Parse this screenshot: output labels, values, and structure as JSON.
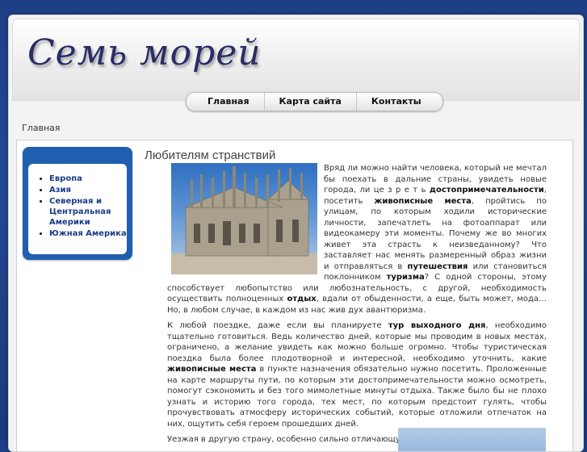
{
  "site": {
    "title": "Семь морей"
  },
  "nav": [
    "Главная",
    "Карта сайта",
    "Контакты"
  ],
  "breadcrumb": "Главная",
  "sidebar": {
    "items": [
      "Европа",
      "Азия",
      "Северная и Центральная Америки",
      "Южная Америка"
    ]
  },
  "article": {
    "title": "Любителям странствий",
    "p1_a": "Вряд ли можно найти человека, который не     мечтал бы поехать в дальние страны, увидеть новые города, ли це з р е т ь ",
    "p1_b": "достопримечательности",
    "p1_c": ", посетить ",
    "p1_d": "живописные места",
    "p1_e": ", пройтись по улицам, по которым ходили исторические     личности, запечатлеть на фотоаппарат или видеокамеру эти моменты. Почему же во многих живет эта страсть к     неизведанному? Что заставляет нас     менять размеренный образ жизни и      отправляться в      ",
    "p1_f": "путешествия",
    "p1_g": " или становиться поклонником      ",
    "p1_h": "туризма",
    "p1_i": "? С одной стороны, этому способствует       любопытство или любознательность, с другой, необходимость осуществить  полноценных ",
    "p1_j": "отдых",
    "p1_k": ", вдали от обыденности, а еще, быть может, мода… Но, в     любом случае, в каждом из   нас жив дух авантюризма.",
    "p2_a": "К любой поездке, даже если вы планируете   ",
    "p2_b": "тур выходного дня",
    "p2_c": ", необходимо тщательно готовиться. Ведь количество  дней, которые мы  проводим в новых местах, ограничено, а желание увидеть как можно больше огромно. Чтобы туристическая поездка была более плодотворной и  интересной, необходимо уточнить, какие   ",
    "p2_d": "живописные места",
    "p2_e": " в пункте назначения обязательно нужно посетить. Проложенные на карте      маршруты пути, по которым эти достопримечательности можно осмотреть,     помогут сэкономить и без того мимолетные минуты отдыха. Также было бы  не плохо узнать и историю того города, тех мест, по которым предстоит     гулять, чтобы прочувствовать атмосферу исторических событий, которые отложили отпечаток на них, ощутить себя героем прошедших дней.",
    "p3": "Уезжая в другую страну, особенно сильно     отличающуюся от нашей по     менталитету,"
  },
  "colors": {
    "background": "#1d3f86",
    "sidebar": "#1f5faf",
    "link": "#1a3d8a",
    "logo": "#2a2c66"
  },
  "images": {
    "photo": "gothic-cathedral-photo",
    "photo2": "landscape-photo"
  }
}
